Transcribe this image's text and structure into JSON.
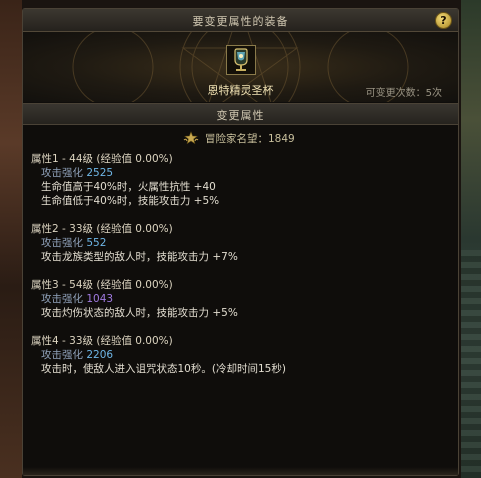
{
  "window": {
    "title": "要变更属性的装备",
    "help_symbol": "?"
  },
  "equipment": {
    "icon": "chalice-item-icon",
    "name": "恩特精灵圣杯",
    "change_count_text": "可变更次数：5次"
  },
  "section": {
    "title": "变更属性"
  },
  "fame": {
    "icon": "fame-emblem-icon",
    "label": "冒险家名望：1849"
  },
  "attributes": [
    {
      "title": "属性1 - 44级 (经验值 0.00%)",
      "stat_label": "攻击强化",
      "stat_value": "2525",
      "effects": [
        "生命值高于40%时，火属性抗性 +40",
        "生命值低于40%时，技能攻击力 +5%"
      ]
    },
    {
      "title": "属性2 - 33级 (经验值 0.00%)",
      "stat_label": "攻击强化",
      "stat_value": "552",
      "effects": [
        "攻击龙族类型的敌人时，技能攻击力 +7%"
      ]
    },
    {
      "title": "属性3 - 54级 (经验值 0.00%)",
      "stat_label": "攻击强化",
      "stat_value": "1043",
      "effects": [
        "攻击灼伤状态的敌人时，技能攻击力 +5%"
      ]
    },
    {
      "title": "属性4 - 33级 (经验值 0.00%)",
      "stat_label": "攻击强化",
      "stat_value": "2206",
      "effects": [
        "攻击时，使敌人进入诅咒状态10秒。(冷却时间15秒)"
      ]
    }
  ],
  "colors": {
    "stat_value_blue": "#6fb6e6",
    "stat_value_purple": "#a07ae0",
    "title_gold": "#f0e2b4"
  }
}
